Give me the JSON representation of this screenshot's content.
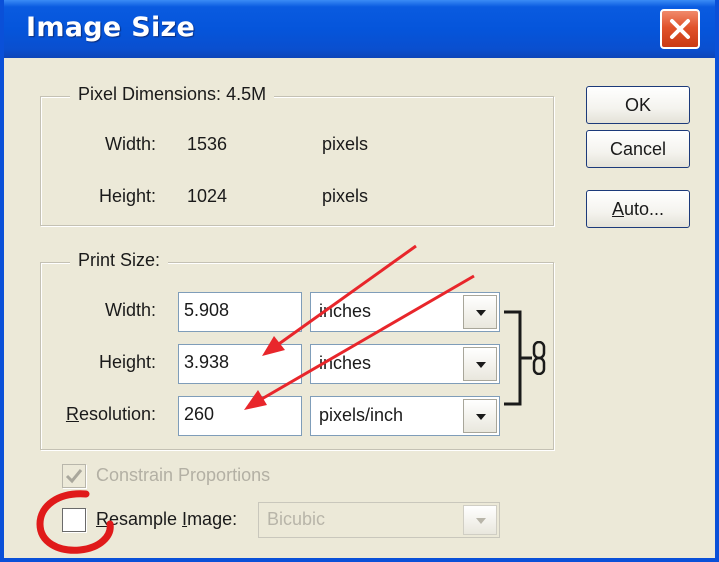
{
  "dialog": {
    "title": "Image Size",
    "close_label": "✕"
  },
  "pixel_dimensions": {
    "legend": "Pixel Dimensions:",
    "size": "4.5M",
    "width_label": "Width:",
    "width_value": "1536",
    "width_unit": "pixels",
    "height_label": "Height:",
    "height_value": "1024",
    "height_unit": "pixels"
  },
  "print_size": {
    "legend": "Print Size:",
    "width_label": "Width:",
    "width_value": "5.908",
    "width_unit": "inches",
    "height_label": "Height:",
    "height_value": "3.938",
    "height_unit": "inches",
    "resolution_label_first": "R",
    "resolution_label_rest": "esolution:",
    "resolution_value": "260",
    "resolution_unit": "pixels/inch"
  },
  "buttons": {
    "ok": "OK",
    "cancel": "Cancel",
    "auto_first": "A",
    "auto_rest": "uto..."
  },
  "options": {
    "constrain_label": "Constrain Proportions",
    "constrain_checked": true,
    "constrain_enabled": false,
    "resample_label_first": "R",
    "resample_label_mid": "esample ",
    "resample_label_u": "I",
    "resample_label_end": "mage:",
    "resample_checked": false,
    "resample_method": "Bicubic",
    "resample_method_enabled": false
  },
  "annotations": {
    "arrow_color": "#e8262b",
    "circle_color": "#e01a1a"
  },
  "colors": {
    "titlebar_blue": "#0555db",
    "dialog_face": "#ece9d8",
    "close_red": "#e1532b"
  }
}
